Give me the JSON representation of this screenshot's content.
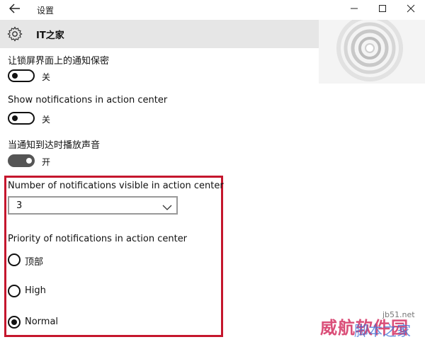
{
  "window": {
    "title": "设置",
    "back_icon": "back-arrow-icon",
    "controls": {
      "minimize": "—",
      "maximize": "☐",
      "close": "✕"
    }
  },
  "header": {
    "icon": "gear-icon",
    "title": "IT之家"
  },
  "settings": {
    "lockscreen_private": {
      "label": "让锁屏界面上的通知保密",
      "state_text": "关",
      "on": false
    },
    "show_in_action_center": {
      "label": "Show notifications in action center",
      "state_text": "关",
      "on": false
    },
    "play_sound": {
      "label": "当通知到达时播放声音",
      "state_text": "开",
      "on": true
    }
  },
  "visible_count": {
    "label": "Number of notifications visible in action center",
    "value": "3"
  },
  "priority": {
    "label": "Priority of notifications in action center",
    "options": [
      {
        "label": "顶部",
        "selected": false
      },
      {
        "label": "High",
        "selected": false
      },
      {
        "label": "Normal",
        "selected": true
      }
    ]
  },
  "watermark": {
    "red_text": "威航软件园",
    "blue_text": "脚本之家",
    "small_text": "jb51.net"
  },
  "colors": {
    "highlight_border": "#c5162d",
    "header_bg": "#e6e6e6"
  }
}
